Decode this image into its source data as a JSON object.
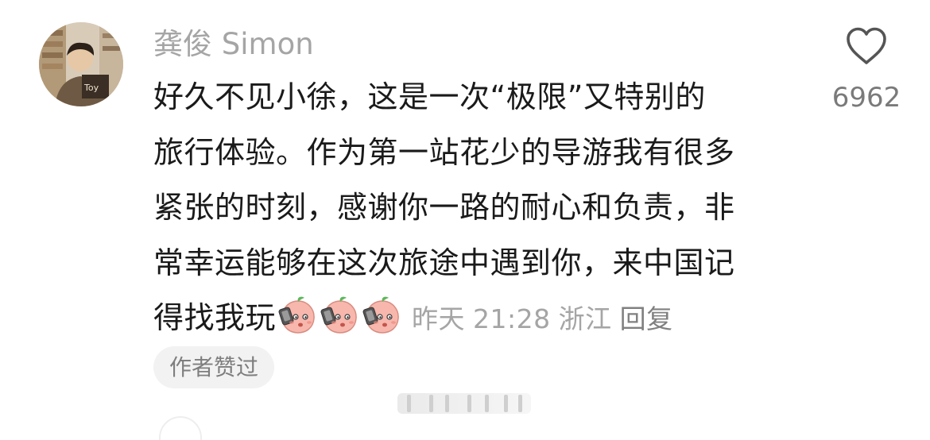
{
  "comment": {
    "username": "龚俊 Simon",
    "lines": [
      "好久不见小徐，这是一次“极限”又特别的",
      "旅行体验。作为第一站花少的导游我有很多",
      "紧张的时刻，感谢你一路的耐心和负责，非",
      "常幸运能够在这次旅途中遇到你，来中国记",
      "得找我玩"
    ],
    "emoji_count": 3,
    "emoji_name": "peach-emoji",
    "date": "昨天",
    "time": "21:28",
    "location": "浙江",
    "reply_label": "回复",
    "author_liked_label": "作者赞过",
    "like_count": "6962"
  },
  "icons": {
    "like": "heart-outline-icon",
    "avatar": "user-avatar-photo"
  },
  "colors": {
    "username": "#a5a5a5",
    "body_text": "#1a1a1a",
    "meta_text": "#a5a5a5",
    "tag_background": "#f2f2f2",
    "emoji_peach": "#f7b7ad"
  }
}
